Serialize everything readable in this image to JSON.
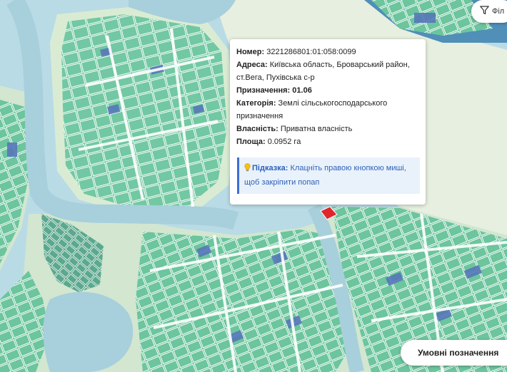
{
  "popup": {
    "number_label": "Номер:",
    "number_value": "3221286801:01:058:0099",
    "address_label": "Адреса:",
    "address_value": "Київська область, Броварський район, ст.Вега, Пухівська с-р",
    "purpose_label": "Призначення:",
    "purpose_value": "01.06",
    "category_label": "Категорія:",
    "category_value": "Землі сільськогосподарського призначення",
    "ownership_label": "Власність:",
    "ownership_value": "Приватна власність",
    "area_label": "Площа:",
    "area_value": "0.0952 га",
    "hint_label": "Підказка:",
    "hint_value": "Клацніть правою кнопкою миші, щоб закріпити попап"
  },
  "filter_button": {
    "label": "Філ",
    "icon": "funnel-icon"
  },
  "legend_button": {
    "label": "Умовні позначення",
    "icon": "chevron-right-icon"
  },
  "colors": {
    "water": "#b9dbe6",
    "land": "#d6edd2",
    "parcel": "#5fbf94",
    "parcel_alt": "#7ccfa8",
    "parcel_dark": "#5677b9",
    "river": "#a8cfdc",
    "selected": "#e0262b",
    "hint_border": "#3a6fd8"
  }
}
